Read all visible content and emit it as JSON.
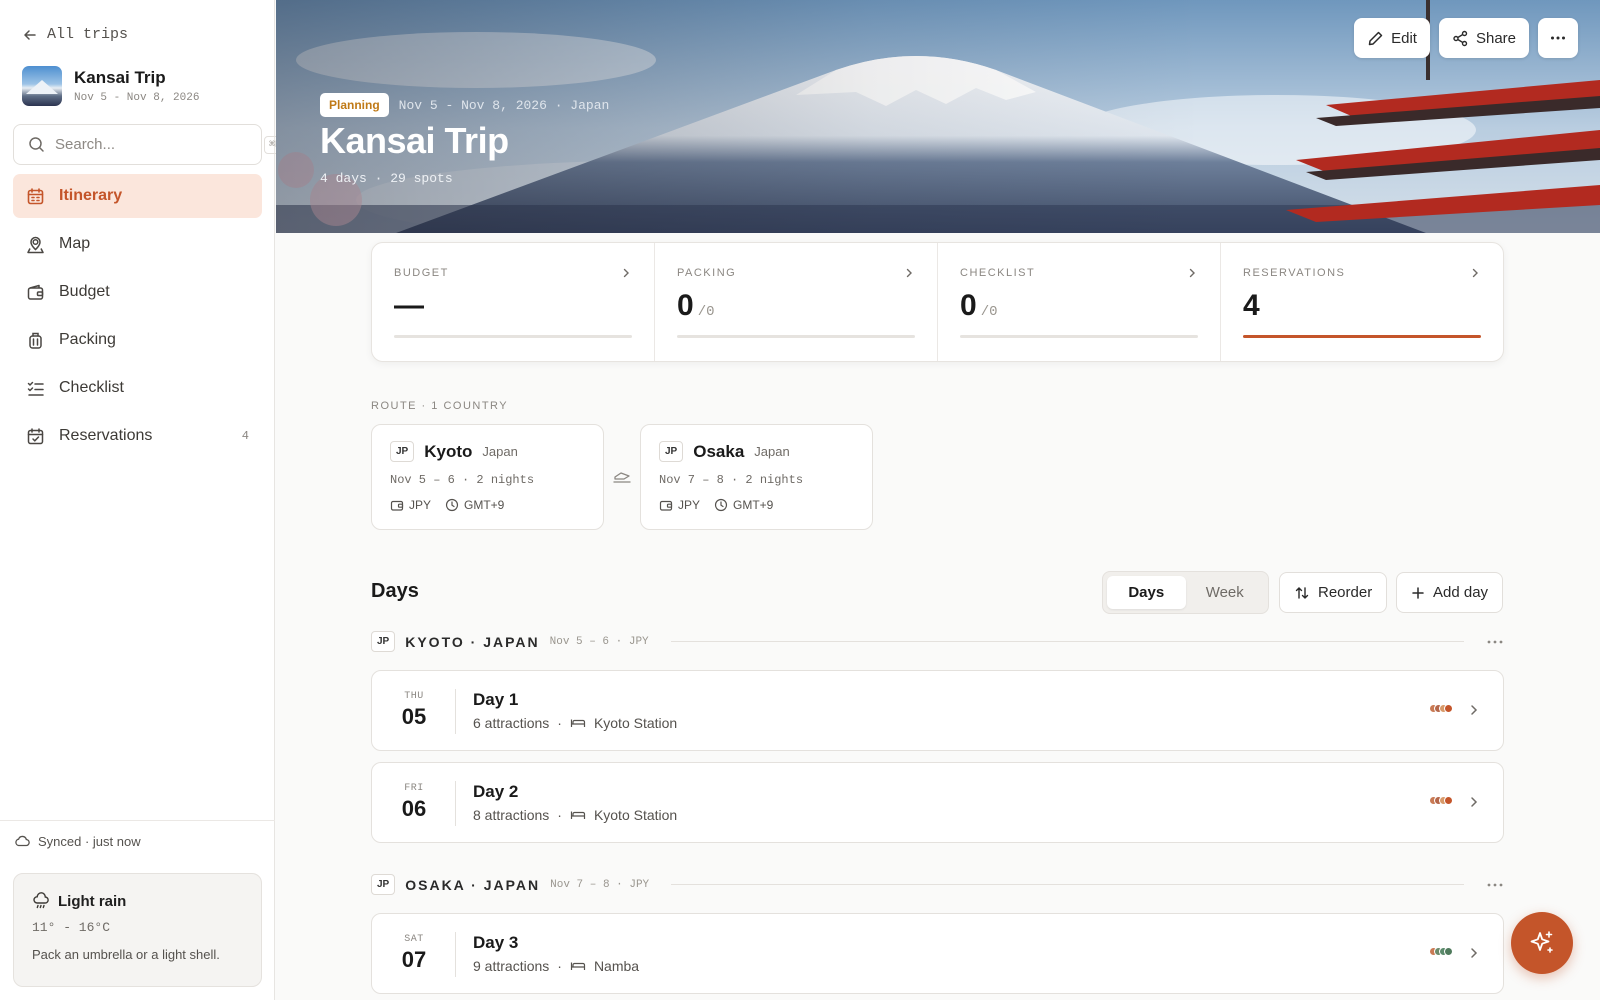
{
  "sidebar": {
    "back_label": "All trips",
    "trip_name": "Kansai Trip",
    "trip_dates": "Nov 5 - Nov 8, 2026",
    "search_placeholder": "Search...",
    "search_shortcut": "⌘K",
    "nav": [
      {
        "label": "Itinerary",
        "icon": "calendar-icon",
        "active": true
      },
      {
        "label": "Map",
        "icon": "map-pin-icon"
      },
      {
        "label": "Budget",
        "icon": "wallet-icon"
      },
      {
        "label": "Packing",
        "icon": "luggage-icon"
      },
      {
        "label": "Checklist",
        "icon": "checklist-icon"
      },
      {
        "label": "Reservations",
        "icon": "calendar-check-icon",
        "count": "4"
      }
    ],
    "sync_status": "Synced · just now",
    "weather": {
      "title": "Light rain",
      "temps": "11° - 16°C",
      "tip": "Pack an umbrella or a light shell."
    }
  },
  "hero": {
    "status": "Planning",
    "meta": "Nov 5 - Nov 8, 2026 · Japan",
    "title": "Kansai Trip",
    "subtitle": "4 days · 29 spots",
    "actions": {
      "edit": "Edit",
      "share": "Share"
    }
  },
  "stats": [
    {
      "label": "BUDGET",
      "value": "—",
      "suffix": "",
      "progress": 0
    },
    {
      "label": "PACKING",
      "value": "0",
      "suffix": "/0",
      "progress": 0
    },
    {
      "label": "CHECKLIST",
      "value": "0",
      "suffix": "/0",
      "progress": 0
    },
    {
      "label": "RESERVATIONS",
      "value": "4",
      "suffix": "",
      "progress": 1
    }
  ],
  "route": {
    "label": "ROUTE · 1 COUNTRY",
    "cities": [
      {
        "code": "JP",
        "name": "Kyoto",
        "country": "Japan",
        "dates": "Nov 5 – 6 · 2 nights",
        "currency": "JPY",
        "tz": "GMT+9"
      },
      {
        "code": "JP",
        "name": "Osaka",
        "country": "Japan",
        "dates": "Nov 7 – 8 · 2 nights",
        "currency": "JPY",
        "tz": "GMT+9"
      }
    ]
  },
  "days": {
    "title": "Days",
    "view_days": "Days",
    "view_week": "Week",
    "reorder": "Reorder",
    "add_day": "Add day",
    "groups": [
      {
        "code": "JP",
        "title": "KYOTO · JAPAN",
        "meta": "Nov 5 – 6 · JPY"
      },
      {
        "code": "JP",
        "title": "OSAKA · JAPAN",
        "meta": "Nov 7 – 8 · JPY"
      }
    ],
    "items": [
      {
        "dow": "THU",
        "num": "05",
        "title": "Day 1",
        "attractions": "6 attractions",
        "sep": "·",
        "stay": "Kyoto Station",
        "dot_colors": [
          "#c97a54",
          "#b5674a",
          "#d89a6a",
          "#c4552a"
        ]
      },
      {
        "dow": "FRI",
        "num": "06",
        "title": "Day 2",
        "attractions": "8 attractions",
        "sep": "·",
        "stay": "Kyoto Station",
        "dot_colors": [
          "#c97a54",
          "#b5674a",
          "#d89a6a",
          "#c4552a"
        ]
      },
      {
        "dow": "SAT",
        "num": "07",
        "title": "Day 3",
        "attractions": "9 attractions",
        "sep": "·",
        "stay": "Namba",
        "dot_colors": [
          "#c97a54",
          "#6b8a6a",
          "#5a8a6b",
          "#4f7a5c"
        ]
      }
    ]
  },
  "colors": {
    "accent": "#c4552a",
    "badge_text": "#c07a17"
  }
}
